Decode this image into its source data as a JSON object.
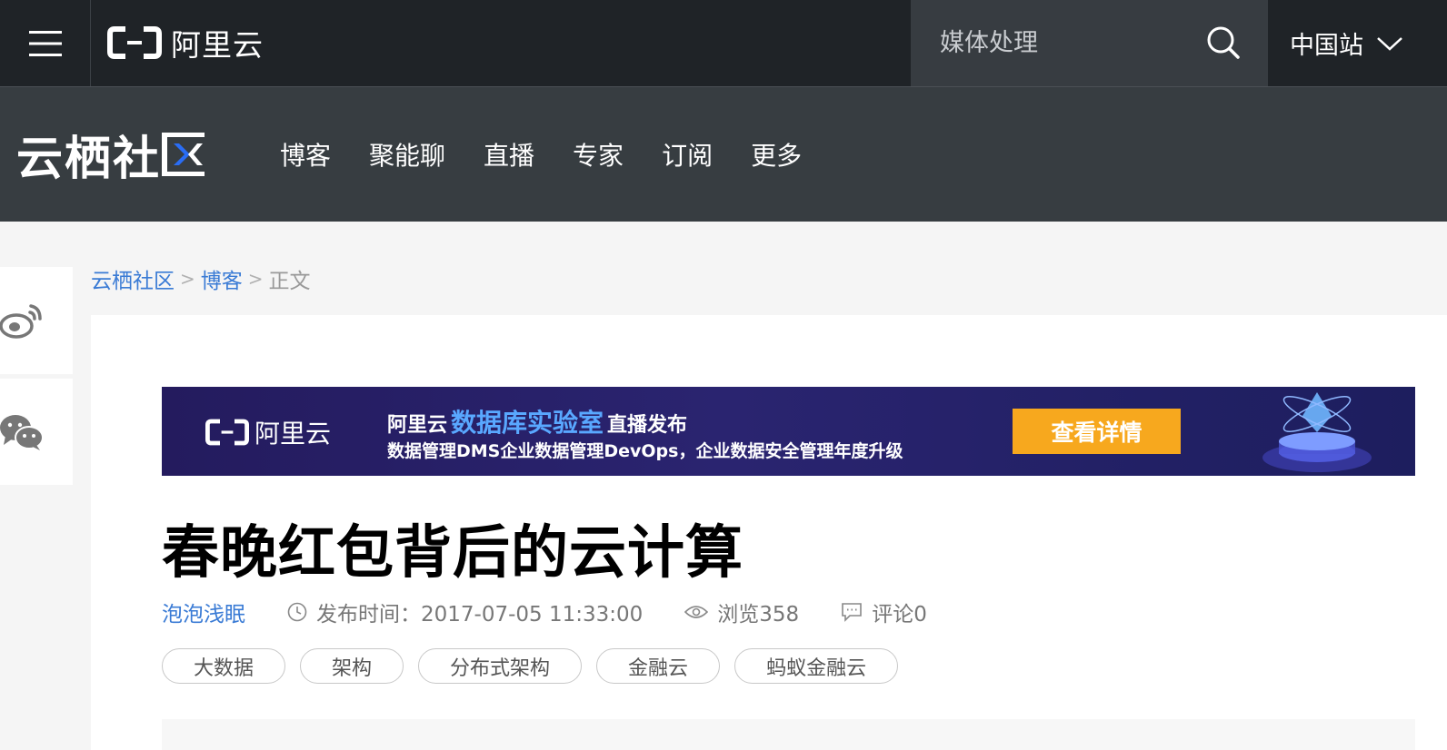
{
  "topbar": {
    "logo_text": "阿里云",
    "search_placeholder": "媒体处理",
    "region_label": "中国站",
    "icons": [
      "menu-icon",
      "search-icon",
      "chevron-down-icon"
    ]
  },
  "navbar": {
    "brand_text": "云栖社",
    "items": [
      {
        "label": "博客"
      },
      {
        "label": "聚能聊"
      },
      {
        "label": "直播"
      },
      {
        "label": "专家"
      },
      {
        "label": "订阅"
      },
      {
        "label": "更多"
      }
    ]
  },
  "share": {
    "icons": [
      "weibo-icon",
      "wechat-icon"
    ]
  },
  "breadcrumb": {
    "items": [
      "云栖社区",
      "博客"
    ],
    "separator": ">",
    "current": "正文"
  },
  "banner": {
    "logo_text": "阿里云",
    "line1_prefix": "阿里云",
    "line1_highlight": "数据库实验室",
    "line1_suffix": "直播发布",
    "line2": "数据管理DMS企业数据管理DevOps，企业数据安全管理年度升级",
    "button_label": "查看详情"
  },
  "article": {
    "title": "春晚红包背后的云计算",
    "author": "泡泡浅眠",
    "publish_time": "发布时间：2017-07-05  11:33:00",
    "views": "浏览358",
    "comments": "评论0",
    "tags": [
      "大数据",
      "架构",
      "分布式架构",
      "金融云",
      "蚂蚁金融云"
    ]
  },
  "colors": {
    "topbar_bg": "#1f2327",
    "navbar_bg": "#373d41",
    "link_blue": "#3a7bd5",
    "banner_button": "#f7a81e"
  }
}
